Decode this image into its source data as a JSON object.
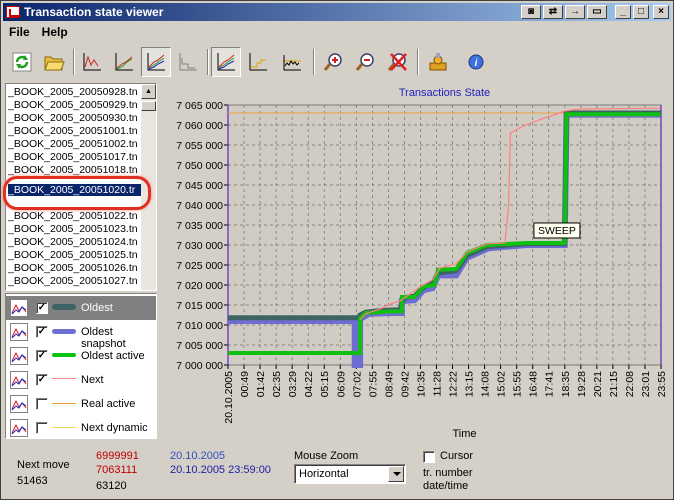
{
  "window": {
    "title": "Transaction state viewer"
  },
  "menu": {
    "file": "File",
    "help": "Help"
  },
  "files": [
    "_BOOK_2005_20050928.tn",
    "_BOOK_2005_20050929.tn",
    "_BOOK_2005_20050930.tn",
    "_BOOK_2005_20051001.tn",
    "_BOOK_2005_20051002.tn",
    "_BOOK_2005_20051017.tn",
    "_BOOK_2005_20051018.tn",
    "_BOOK_2005_20051020.tr",
    "_BOOK_2005_20051022.tn",
    "_BOOK_2005_20051023.tn",
    "_BOOK_2005_20051024.tn",
    "_BOOK_2005_20051025.tn",
    "_BOOK_2005_20051026.tn",
    "_BOOK_2005_20051027.tn"
  ],
  "legend": [
    {
      "label": "Oldest",
      "checked": true,
      "color": "#3c6464"
    },
    {
      "label": "Oldest snapshot",
      "checked": true,
      "color": "#6e6ed2"
    },
    {
      "label": "Oldest active",
      "checked": true,
      "color": "#10c010"
    },
    {
      "label": "Next",
      "checked": true,
      "color": "#ff8080"
    },
    {
      "label": "Real active",
      "checked": false,
      "color": "#f0a040"
    },
    {
      "label": "Next dynamic",
      "checked": false,
      "color": "#e0e040"
    }
  ],
  "chart_data": {
    "type": "line",
    "title": "Transactions State",
    "xlabel": "Time",
    "annotation": "SWEEP",
    "y_ticks": [
      "7 000 000",
      "7 005 000",
      "7 010 000",
      "7 015 000",
      "7 020 000",
      "7 025 000",
      "7 030 000",
      "7 035 000",
      "7 040 000",
      "7 045 000",
      "7 050 000",
      "7 055 000",
      "7 060 000",
      "7 065 000"
    ],
    "ylim": [
      6999991,
      7065000
    ],
    "x_ticks": [
      "20.10.2005",
      "00:49",
      "01:42",
      "02:35",
      "03:29",
      "04:22",
      "05:15",
      "06:09",
      "07:02",
      "07:55",
      "08:49",
      "09:42",
      "10:35",
      "11:28",
      "12:22",
      "13:15",
      "14:08",
      "15:02",
      "15:55",
      "16:48",
      "17:41",
      "18:35",
      "19:28",
      "20:21",
      "21:15",
      "22:08",
      "23:01",
      "23:55"
    ],
    "series": [
      {
        "name": "Oldest",
        "color": "#3c6464",
        "width": 5,
        "points": [
          [
            0,
            7011800
          ],
          [
            7.3,
            7011800
          ],
          [
            7.3,
            7012500
          ],
          [
            7.6,
            7013200
          ],
          [
            8.4,
            7013600
          ],
          [
            9.5,
            7013800
          ],
          [
            9.7,
            7016800
          ],
          [
            10.3,
            7017200
          ],
          [
            10.8,
            7019400
          ],
          [
            11.3,
            7020400
          ],
          [
            11.6,
            7023000
          ],
          [
            12.6,
            7023600
          ],
          [
            13.2,
            7027400
          ],
          [
            14.3,
            7029600
          ],
          [
            16.5,
            7030300
          ],
          [
            18.6,
            7030300
          ],
          [
            18.7,
            7063000
          ],
          [
            23.9,
            7063000
          ]
        ]
      },
      {
        "name": "Oldest snapshot",
        "color": "#6e6ed2",
        "width": 6,
        "points": [
          [
            0,
            7011000
          ],
          [
            7.0,
            7011000
          ],
          [
            7.0,
            7000000
          ],
          [
            7.3,
            7000000
          ],
          [
            7.3,
            7011500
          ],
          [
            7.8,
            7012800
          ],
          [
            9.0,
            7013000
          ],
          [
            9.6,
            7013000
          ],
          [
            9.6,
            7016000
          ],
          [
            10.3,
            7016200
          ],
          [
            10.8,
            7018700
          ],
          [
            11.3,
            7019200
          ],
          [
            11.6,
            7022400
          ],
          [
            12.6,
            7022400
          ],
          [
            13.2,
            7026800
          ],
          [
            14.4,
            7029200
          ],
          [
            16.5,
            7030000
          ],
          [
            18.6,
            7030000
          ],
          [
            18.7,
            7062600
          ],
          [
            23.9,
            7062600
          ]
        ]
      },
      {
        "name": "Oldest active",
        "color": "#10c010",
        "width": 4,
        "points": [
          [
            0,
            7003000
          ],
          [
            7.3,
            7003000
          ],
          [
            7.3,
            7011700
          ],
          [
            7.6,
            7013000
          ],
          [
            9.0,
            7013400
          ],
          [
            9.6,
            7013400
          ],
          [
            9.6,
            7017000
          ],
          [
            10.3,
            7017000
          ],
          [
            10.8,
            7019600
          ],
          [
            11.4,
            7020000
          ],
          [
            11.6,
            7023800
          ],
          [
            12.6,
            7024000
          ],
          [
            13.2,
            7028000
          ],
          [
            14.3,
            7030000
          ],
          [
            16.5,
            7030500
          ],
          [
            18.6,
            7030500
          ],
          [
            18.7,
            7062700
          ],
          [
            23.9,
            7062700
          ]
        ]
      },
      {
        "name": "Next",
        "color": "#ff8080",
        "width": 1.2,
        "points": [
          [
            7.3,
            7011400
          ],
          [
            7.6,
            7012800
          ],
          [
            8.4,
            7014000
          ],
          [
            9.0,
            7015300
          ],
          [
            9.5,
            7016000
          ],
          [
            10.0,
            7017600
          ],
          [
            10.7,
            7019800
          ],
          [
            11.3,
            7021300
          ],
          [
            11.7,
            7024200
          ],
          [
            12.6,
            7025300
          ],
          [
            13.2,
            7028200
          ],
          [
            14.3,
            7030300
          ],
          [
            15.3,
            7030500
          ],
          [
            15.5,
            7040000
          ],
          [
            15.6,
            7058000
          ],
          [
            16.2,
            7059500
          ],
          [
            17.0,
            7061000
          ],
          [
            18.0,
            7062500
          ],
          [
            18.6,
            7063500
          ],
          [
            19.5,
            7064000
          ],
          [
            23.9,
            7064200
          ]
        ]
      },
      {
        "name": "Real active",
        "color": "#f0a040",
        "width": 1,
        "points": [
          [
            0,
            7063000
          ],
          [
            23.9,
            7063000
          ]
        ]
      }
    ]
  },
  "bottom": {
    "next_move_label": "Next move",
    "next_move_value": "51463",
    "v1": "6999991",
    "v2": "7063111",
    "v3": "63120",
    "date": "20.10.2005",
    "datetime": "20.10.2005 23:59:00",
    "mouse_zoom_label": "Mouse Zoom",
    "zoom_value": "Horizontal",
    "cursor_label": "Cursor",
    "tr_number_label": "tr. number",
    "datetime_label": "date/time"
  },
  "colors": {
    "red_value": "#c00000",
    "blue_value": "#3050c0",
    "chart_title": "#2020c0"
  }
}
